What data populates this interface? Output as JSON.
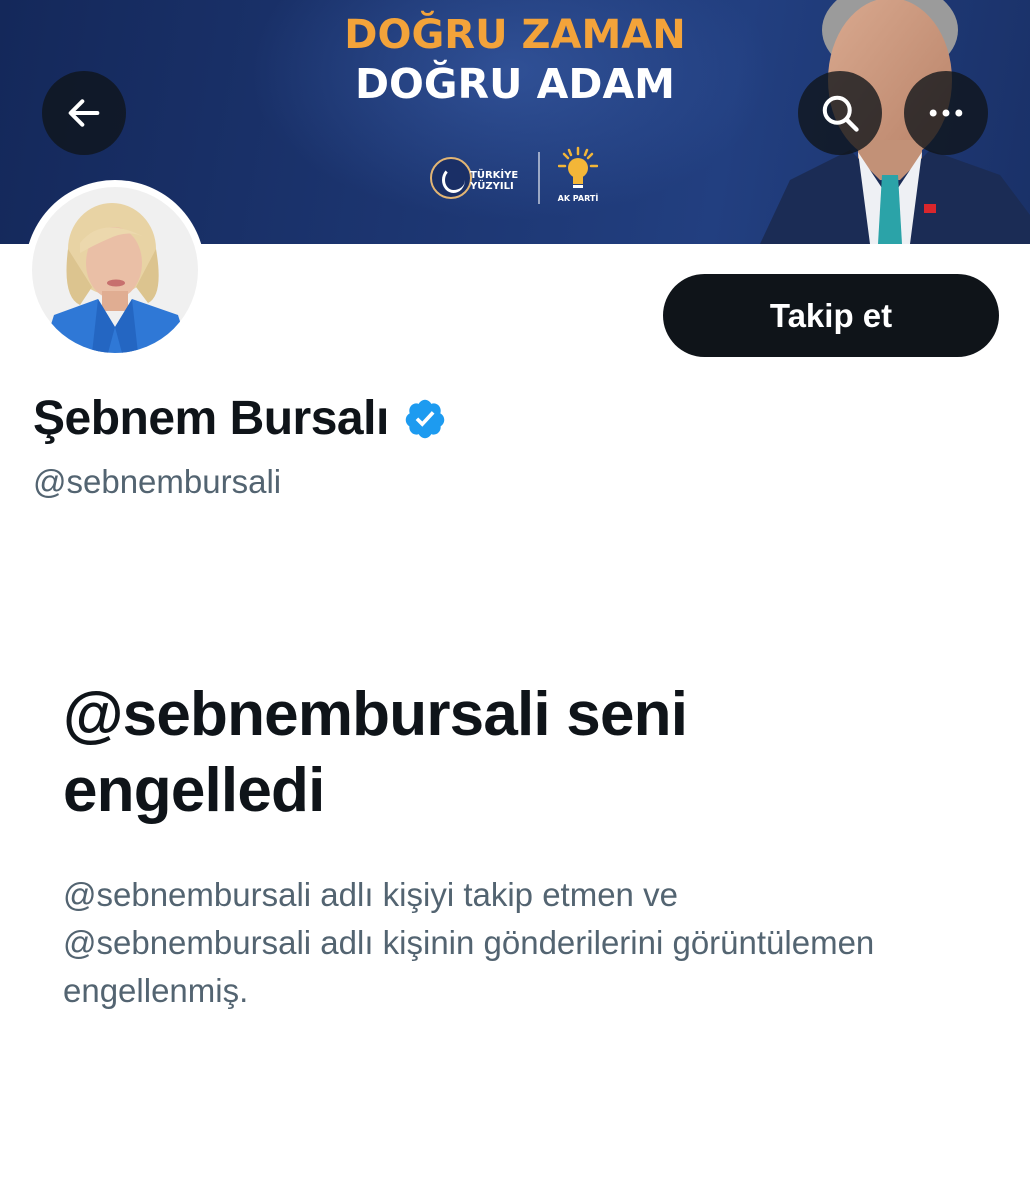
{
  "banner": {
    "slogan_line1": "DOĞRU ZAMAN",
    "slogan_line2": "DOĞRU ADAM",
    "logo_left_line1": "TÜRKİYE",
    "logo_left_line2": "YÜZYILI",
    "logo_right_text": "AK PARTİ",
    "accent_color": "#f3a33a",
    "background_color": "#1c3570"
  },
  "header_actions": {
    "back_icon": "arrow-left-icon",
    "search_icon": "search-icon",
    "more_icon": "more-horizontal-icon"
  },
  "profile": {
    "display_name": "Şebnem Bursalı",
    "handle": "@sebnembursali",
    "verified": true,
    "verified_color": "#1d9bf0",
    "follow_label": "Takip et"
  },
  "blocked_notice": {
    "title": "@sebnembursali seni engelledi",
    "description": "@sebnembursali adlı kişiyi takip etmen ve @sebnembursali adlı kişinin gönderilerini görüntülemen engellenmiş."
  }
}
